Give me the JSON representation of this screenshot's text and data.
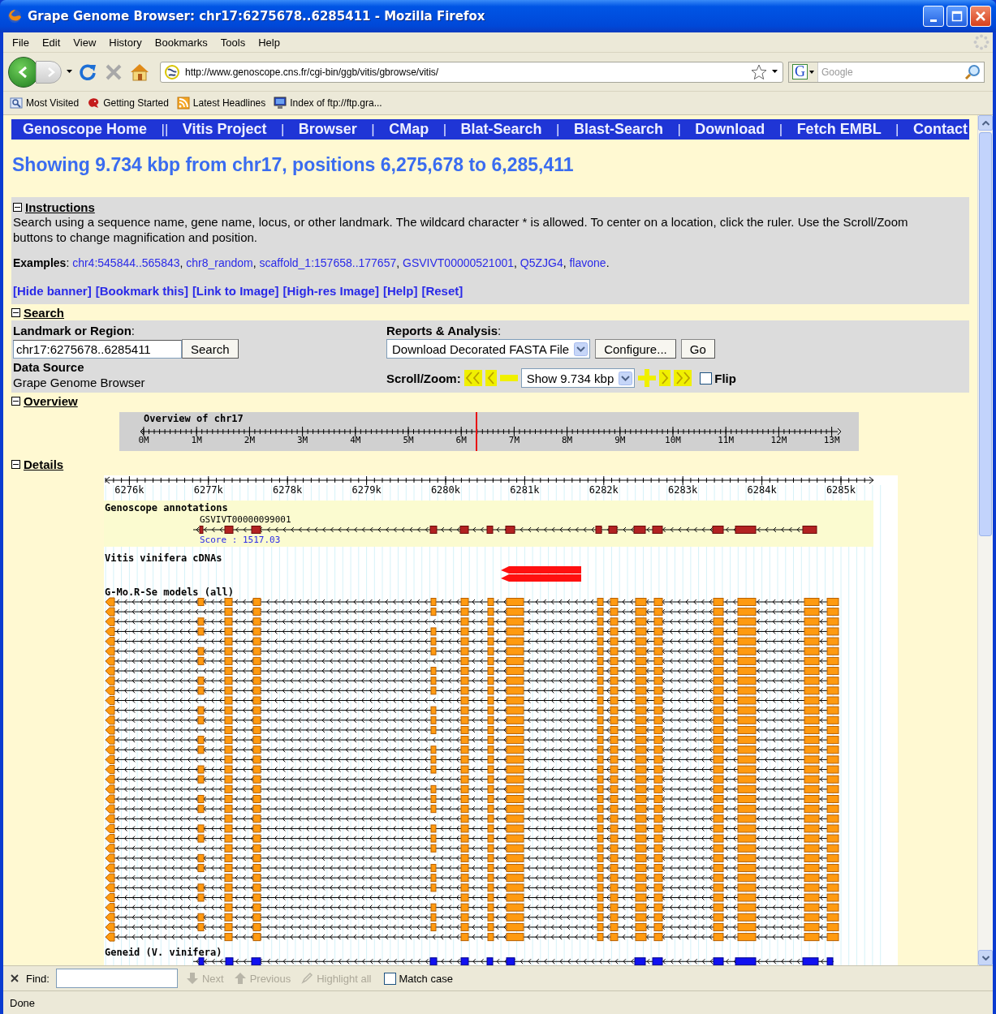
{
  "window": {
    "title": "Grape Genome Browser: chr17:6275678..6285411 - Mozilla Firefox"
  },
  "menu": [
    "File",
    "Edit",
    "View",
    "History",
    "Bookmarks",
    "Tools",
    "Help"
  ],
  "toolbar": {
    "url": "http://www.genoscope.cns.fr/cgi-bin/ggb/vitis/gbrowse/vitis/",
    "search_engine": "G",
    "search_placeholder": "Google"
  },
  "bookmarks": [
    "Most Visited",
    "Getting Started",
    "Latest Headlines",
    "Index of ftp://ftp.gra..."
  ],
  "nav_links": [
    {
      "label": "Genoscope Home",
      "separator": "||"
    },
    {
      "label": "Vitis Project",
      "separator": "|"
    },
    {
      "label": "Browser",
      "separator": "|"
    },
    {
      "label": "CMap",
      "separator": "|"
    },
    {
      "label": "Blat-Search",
      "separator": "|"
    },
    {
      "label": "Blast-Search",
      "separator": "|"
    },
    {
      "label": "Download",
      "separator": "|"
    },
    {
      "label": "Fetch EMBL",
      "separator": "|"
    },
    {
      "label": "Contact"
    }
  ],
  "heading": "Showing 9.734 kbp from chr17, positions 6,275,678 to 6,285,411",
  "instructions": {
    "title": "Instructions",
    "expanded": true,
    "text": "Search using a sequence name, gene name, locus, or other landmark. The wildcard character * is allowed. To center on a location, click the ruler. Use the Scroll/Zoom buttons to change magnification and position.",
    "examples_label": "**Examples**:",
    "examples": [
      {
        "text": "chr4:545844..565843",
        "separator": ","
      },
      {
        "text": "chr8_random",
        "separator": ","
      },
      {
        "text": "scaffold_1:157658..177657",
        "separator": ","
      },
      {
        "text": "GSVIVT00000521001",
        "separator": ","
      },
      {
        "text": "Q5ZJG4",
        "separator": ","
      },
      {
        "text": "flavone",
        "separator": "."
      }
    ],
    "links": [
      "[Hide banner]",
      "[Bookmark this]",
      "[Link to Image]",
      "[High-res Image]",
      "[Help]",
      "[Reset]"
    ]
  },
  "search": {
    "title": "Search",
    "expanded": true,
    "landmark_label": "**Landmark or Region**:",
    "landmark_value": "chr17:6275678..6285411",
    "search_button": "Search",
    "source_label": "Data Source",
    "source_value": "Grape Genome Browser",
    "reports_label": "**Reports & Analysis**:",
    "report_value": "Download Decorated FASTA File",
    "configure_button": "Configure...",
    "go_button": "Go",
    "scroll_label": "Scroll/Zoom:",
    "zoom_value": "Show 9.734 kbp",
    "flip": {
      "label": "Flip",
      "checked": false
    }
  },
  "overview": {
    "title": "Overview",
    "expanded": true,
    "label": "Overview of chr17",
    "ticks": [
      "0M",
      "1M",
      "2M",
      "3M",
      "4M",
      "5M",
      "6M",
      "7M",
      "8M",
      "9M",
      "10M",
      "11M",
      "12M",
      "13M"
    ]
  },
  "details": {
    "title": "Details",
    "expanded": true,
    "ruler_ticks": [
      "6276k",
      "6277k",
      "6278k",
      "6279k",
      "6280k",
      "6281k",
      "6282k",
      "6283k",
      "6284k",
      "6285k"
    ],
    "tracks": [
      {
        "kind": "annotation",
        "label": "Genoscope annotations",
        "gene_name": "GSVIVT00000099001",
        "score": "Score : 1517.03"
      },
      {
        "kind": "cdna",
        "label": "Vitis vinifera cDNAs"
      },
      {
        "kind": "models",
        "label": "G-Mo.R-Se models (all)"
      },
      {
        "kind": "geneid",
        "label": "Geneid (V. vinifera)"
      }
    ]
  },
  "find_bar": {
    "label": "Find:",
    "buttons": [
      {
        "kind": "next",
        "label": "Next",
        "disabled": true
      },
      {
        "kind": "previous",
        "label": "Previous",
        "disabled": true
      },
      {
        "kind": "highlight",
        "label": "Highlight all",
        "disabled": true
      }
    ],
    "match_case": {
      "label": "Match case",
      "checked": false
    }
  },
  "status": "Done"
}
